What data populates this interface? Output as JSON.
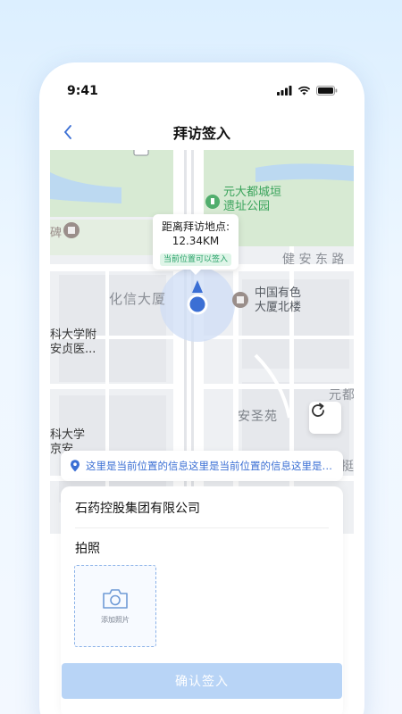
{
  "status_bar": {
    "time": "9:41"
  },
  "header": {
    "title": "拜访签入"
  },
  "map": {
    "callout": {
      "line1": "距离拜访地点:",
      "line2": "12.34KM",
      "badge": "当前位置可以签入"
    },
    "labels": {
      "poi_park_line1": "元大都城垣",
      "poi_park_line2": "遗址公园",
      "road_jianan": "健 安 东 路",
      "building_huaxin": "化信大厦",
      "poi_zhongguo_line1": "中国有色",
      "poi_zhongguo_line2": "大厦北楼",
      "poi_kedafu_line1": "科大学附",
      "poi_kedafu_line2": "安贞医...",
      "poi_kedaxue_line1": "科大学",
      "poi_kedaxue_line2": "京安",
      "area_ansheng": "安圣苑",
      "partial_yuandu": "元都",
      "partial_bei": "碑",
      "partial_ting": "挺"
    }
  },
  "location_text": "这里是当前位置的信息这里是当前位置的信息这里是当前位置的信息",
  "form": {
    "company": "石药控股集团有限公司",
    "photo_label": "拍照",
    "add_photo": "添加照片"
  },
  "confirm_button": "确认签入",
  "colors": {
    "accent": "#3b6fd4",
    "button_disabled": "#b8d4f6",
    "badge_green": "#2aa26a",
    "map_bg": "#eef0f3"
  }
}
